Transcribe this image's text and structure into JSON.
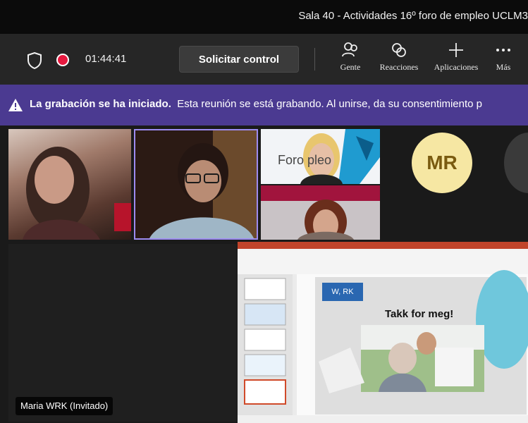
{
  "window": {
    "title": "Sala 40 - Actividades 16º foro de empleo UCLM3"
  },
  "toolbar": {
    "timer": "01:44:41",
    "control_label": "Solicitar control",
    "people_label": "Gente",
    "reactions_label": "Reacciones",
    "apps_label": "Aplicaciones",
    "more_label": "Más"
  },
  "banner": {
    "bold": "La grabación se ha iniciado.",
    "text": "Esta reunión se está grabando. Al unirse, da su consentimiento p"
  },
  "participants": {
    "mr_initials": "MR",
    "shared_name": "Maria WRK (Invitado)"
  },
  "tile_text": {
    "foro": "Foro    pleo"
  },
  "slide": {
    "title": "Takk for meg!",
    "badge": "W, RK"
  },
  "colors": {
    "banner": "#4b3a91",
    "record": "#e6193f",
    "avatar": "#f6e7a3",
    "active_border": "#9d8bf0"
  }
}
